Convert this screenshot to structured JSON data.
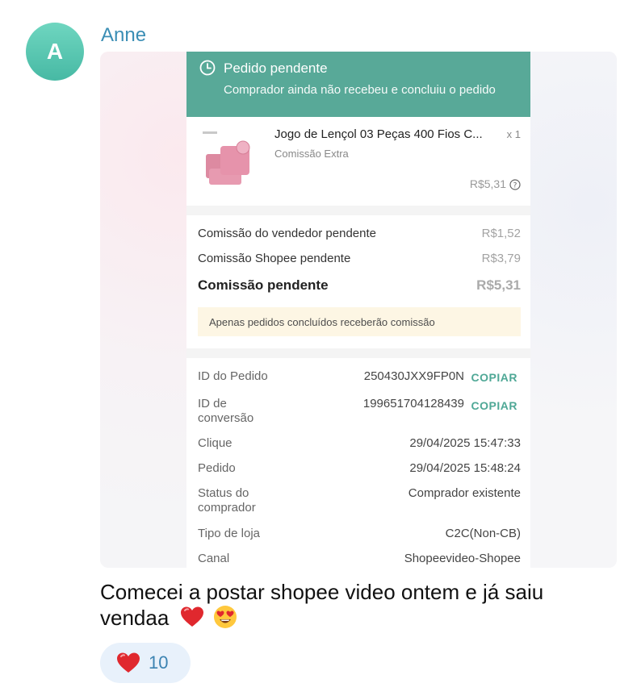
{
  "message": {
    "avatar_letter": "A",
    "sender": "Anne",
    "text": "Comecei a postar shopee video ontem e já saiu vendaa",
    "emojis": [
      "red-heart",
      "heart-eyes-face"
    ],
    "reaction": {
      "emoji": "red-heart",
      "count": "10"
    }
  },
  "screenshot": {
    "banner": {
      "title": "Pedido pendente",
      "subtitle": "Comprador ainda não recebeu e concluiu o pedido"
    },
    "product": {
      "title": "Jogo de Lençol 03 Peças 400 Fios C...",
      "quantity": "x 1",
      "tag": "Comissão Extra",
      "price": "R$5,31"
    },
    "commission": {
      "seller_label": "Comissão do vendedor pendente",
      "seller_value": "R$1,52",
      "shopee_label": "Comissão Shopee pendente",
      "shopee_value": "R$3,79",
      "total_label": "Comissão pendente",
      "total_value": "R$5,31",
      "notice": "Apenas pedidos concluídos receberão comissão"
    },
    "details": {
      "order_id_label": "ID do Pedido",
      "order_id_value": "250430JXX9FP0N",
      "copy_label": "COPIAR",
      "conversion_label_1": "ID de",
      "conversion_label_2": "conversão",
      "conversion_value": "199651704128439",
      "click_label": "Clique",
      "click_value": "29/04/2025 15:47:33",
      "order_label": "Pedido",
      "order_value": "29/04/2025 15:48:24",
      "buyer_status_label_1": "Status do",
      "buyer_status_label_2": "comprador",
      "buyer_status_value": "Comprador existente",
      "store_type_label": "Tipo de loja",
      "store_type_value": "C2C(Non-CB)",
      "channel_label": "Canal",
      "channel_value": "Shopeevideo-Shopee"
    }
  },
  "colors": {
    "banner": "#58a998",
    "accent": "#4fa896",
    "sender": "#3b8eb5",
    "reaction_bg": "#e8f1fb"
  }
}
